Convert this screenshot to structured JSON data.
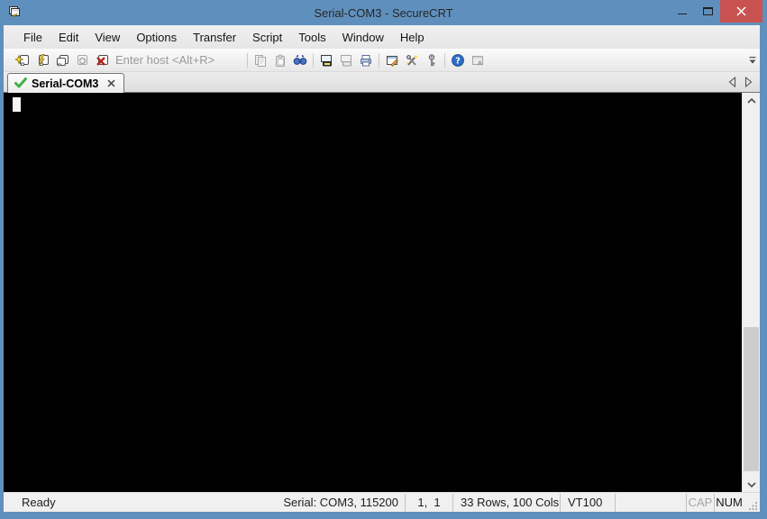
{
  "window": {
    "title": "Serial-COM3 - SecureCRT",
    "control_icons": [
      "minimize-icon",
      "maximize-icon",
      "close-icon"
    ]
  },
  "menu": {
    "items": [
      "File",
      "Edit",
      "View",
      "Options",
      "Transfer",
      "Script",
      "Tools",
      "Window",
      "Help"
    ]
  },
  "toolbar": {
    "host_placeholder": "Enter host <Alt+R>",
    "icons": [
      "connect-icon",
      "quick-connect-icon",
      "connect-in-tab-icon",
      "reconnect-icon",
      "disconnect-icon",
      "copy-icon",
      "paste-icon",
      "find-icon",
      "print-screen-icon",
      "print-selection-icon",
      "print-icon",
      "session-options-icon",
      "global-options-icon",
      "key-agent-icon",
      "help-icon",
      "vshell-icon",
      "toolbar-overflow-icon"
    ]
  },
  "tabbar": {
    "active_tab": {
      "label": "Serial-COM3",
      "status_icon": "connected-check-icon",
      "close_icon": "close-tab-icon"
    },
    "nav_icons": [
      "scroll-tabs-left-icon",
      "scroll-tabs-right-icon"
    ]
  },
  "terminal": {
    "content": "",
    "cursor_style": "block",
    "bg_color": "#000000",
    "cursor_color": "#f4f4f4"
  },
  "status_bar": {
    "ready": "Ready",
    "connection": "Serial: COM3, 115200",
    "cursor_position": "1,  1",
    "grid_size": "33 Rows, 100 Cols",
    "emulation": "VT100",
    "caps_lock": "CAP",
    "num_lock": "NUM"
  },
  "colors": {
    "titlebar": "#5f90bd",
    "close_button": "#c85250",
    "tab_check_green": "#43b049",
    "terminal_bg": "#000000",
    "chrome_bg": "#f0f0f0"
  }
}
